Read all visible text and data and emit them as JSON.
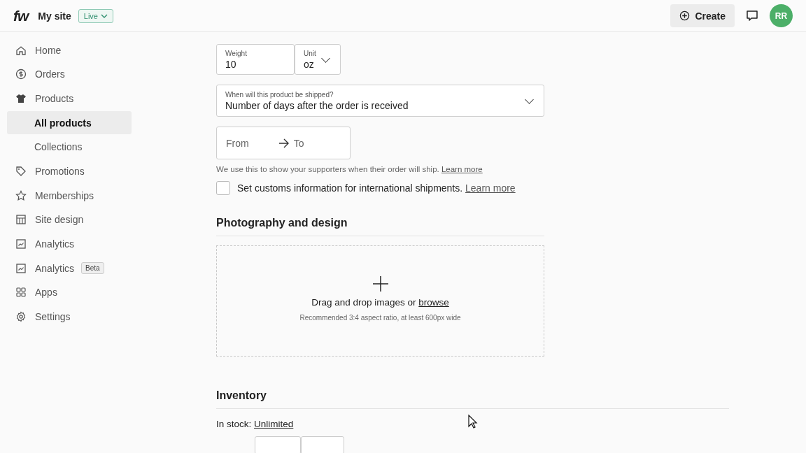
{
  "header": {
    "logo": "fw",
    "site_name": "My site",
    "status": "Live",
    "create_button": "Create",
    "avatar": "RR"
  },
  "sidebar": {
    "items": [
      {
        "label": "Home",
        "selected": false,
        "kind": "main"
      },
      {
        "label": "Orders",
        "selected": false,
        "kind": "main"
      },
      {
        "label": "Products",
        "selected": false,
        "kind": "main"
      },
      {
        "label": "All products",
        "selected": true,
        "kind": "sub"
      },
      {
        "label": "Collections",
        "selected": false,
        "kind": "sub"
      },
      {
        "label": "Promotions",
        "selected": false,
        "kind": "main"
      },
      {
        "label": "Memberships",
        "selected": false,
        "kind": "main"
      },
      {
        "label": "Site design",
        "selected": false,
        "kind": "main"
      },
      {
        "label": "Analytics",
        "selected": false,
        "kind": "main"
      },
      {
        "label": "Analytics",
        "selected": false,
        "kind": "main",
        "badge": "Beta"
      },
      {
        "label": "Apps",
        "selected": false,
        "kind": "main"
      },
      {
        "label": "Settings",
        "selected": false,
        "kind": "main"
      }
    ]
  },
  "shipping": {
    "weight": {
      "label": "Weight",
      "value": "10"
    },
    "unit": {
      "label": "Unit",
      "value": "oz"
    },
    "ship_time": {
      "label": "When will this product be shipped?",
      "value": "Number of days after the order is received"
    },
    "range": {
      "from_placeholder": "From",
      "to_placeholder": "To"
    },
    "help": "We use this to show your supporters when their order will ship.",
    "help_link": "Learn more",
    "customs": {
      "label": "Set customs information for international shipments.",
      "link": "Learn more",
      "checked": false
    }
  },
  "photography": {
    "title": "Photography and design",
    "drop_text": "Drag and drop images or",
    "browse_link": "browse",
    "hint": "Recommended 3:4 aspect ratio, at least 600px wide"
  },
  "inventory": {
    "title": "Inventory",
    "stock_label": "In stock:",
    "stock_link": "Unlimited"
  }
}
